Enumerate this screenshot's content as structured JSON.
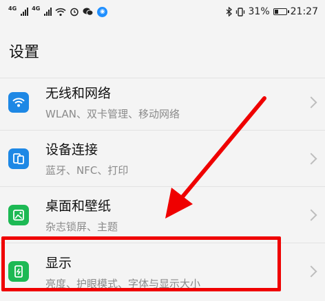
{
  "status_bar": {
    "net1": "4G",
    "net2": "4G",
    "battery_percent": "31%",
    "battery_level": 0.31,
    "time": "21:27"
  },
  "header": {
    "title": "设置"
  },
  "settings": [
    {
      "title": "无线和网络",
      "subtitle": "WLAN、双卡管理、移动网络",
      "icon": "wifi-icon",
      "color": "#1e88e5"
    },
    {
      "title": "设备连接",
      "subtitle": "蓝牙、NFC、打印",
      "icon": "device-connection-icon",
      "color": "#1e88e5"
    },
    {
      "title": "桌面和壁纸",
      "subtitle": "杂志锁屏、主题",
      "icon": "wallpaper-icon",
      "color": "#1db954"
    },
    {
      "title": "显示",
      "subtitle": "亮度、护眼模式、字体与显示大小",
      "icon": "display-icon",
      "color": "#1db954"
    }
  ],
  "annotation_color": "#ef0000"
}
